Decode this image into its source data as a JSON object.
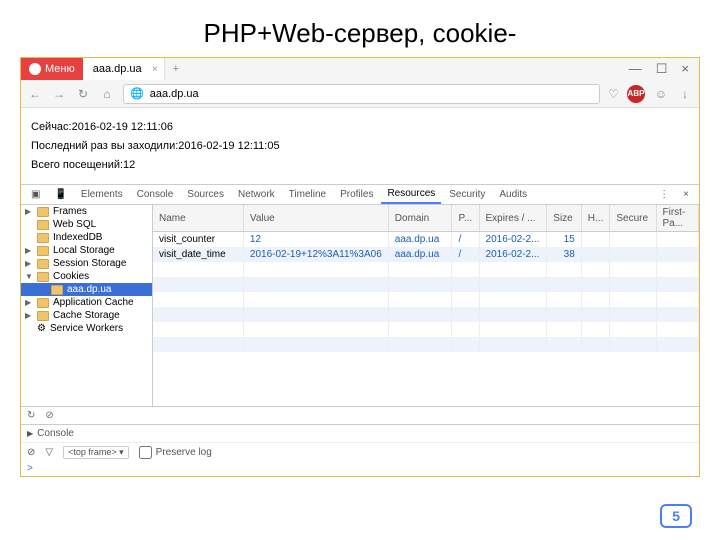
{
  "slide": {
    "title": "PHP+Web-сервер, cookie-",
    "number": "5"
  },
  "browser": {
    "menu_label": "Меню",
    "tab_title": "aaa.dp.ua",
    "url": "aaa.dp.ua",
    "abp": "ABP"
  },
  "page": {
    "line1": "Сейчас:2016-02-19 12:11:06",
    "line2": "Последний раз вы заходили:2016-02-19 12:11:05",
    "line3": "Всего посещений:12"
  },
  "devtools": {
    "tabs": [
      "Elements",
      "Console",
      "Sources",
      "Network",
      "Timeline",
      "Profiles",
      "Resources",
      "Security",
      "Audits"
    ],
    "active_tab": "Resources",
    "sidebar": [
      {
        "label": "Frames",
        "tri": "closed",
        "icon": "folder"
      },
      {
        "label": "Web SQL",
        "tri": "none",
        "icon": "folder"
      },
      {
        "label": "IndexedDB",
        "tri": "none",
        "icon": "folder"
      },
      {
        "label": "Local Storage",
        "tri": "closed",
        "icon": "folder"
      },
      {
        "label": "Session Storage",
        "tri": "closed",
        "icon": "folder"
      },
      {
        "label": "Cookies",
        "tri": "open",
        "icon": "folder"
      },
      {
        "label": "aaa.dp.ua",
        "tri": "none",
        "icon": "folder",
        "selected": true,
        "indent": 1
      },
      {
        "label": "Application Cache",
        "tri": "closed",
        "icon": "folder"
      },
      {
        "label": "Cache Storage",
        "tri": "closed",
        "icon": "folder"
      },
      {
        "label": "Service Workers",
        "tri": "none",
        "icon": "gear"
      }
    ],
    "columns": [
      "Name",
      "Value",
      "Domain",
      "P...",
      "Expires / ...",
      "Size",
      "H...",
      "Secure",
      "First-Pa..."
    ],
    "rows": [
      {
        "name": "visit_counter",
        "value": "12",
        "domain": "aaa.dp.ua",
        "path": "/",
        "expires": "2016-02-2...",
        "size": "15",
        "http": "",
        "secure": "",
        "firstpa": ""
      },
      {
        "name": "visit_date_time",
        "value": "2016-02-19+12%3A11%3A06",
        "domain": "aaa.dp.ua",
        "path": "/",
        "expires": "2016-02-2...",
        "size": "38",
        "http": "",
        "secure": "",
        "firstpa": ""
      }
    ],
    "console": {
      "header": "Console",
      "frame": "<top frame>",
      "preserve_label": "Preserve log",
      "prompt": ">"
    }
  }
}
